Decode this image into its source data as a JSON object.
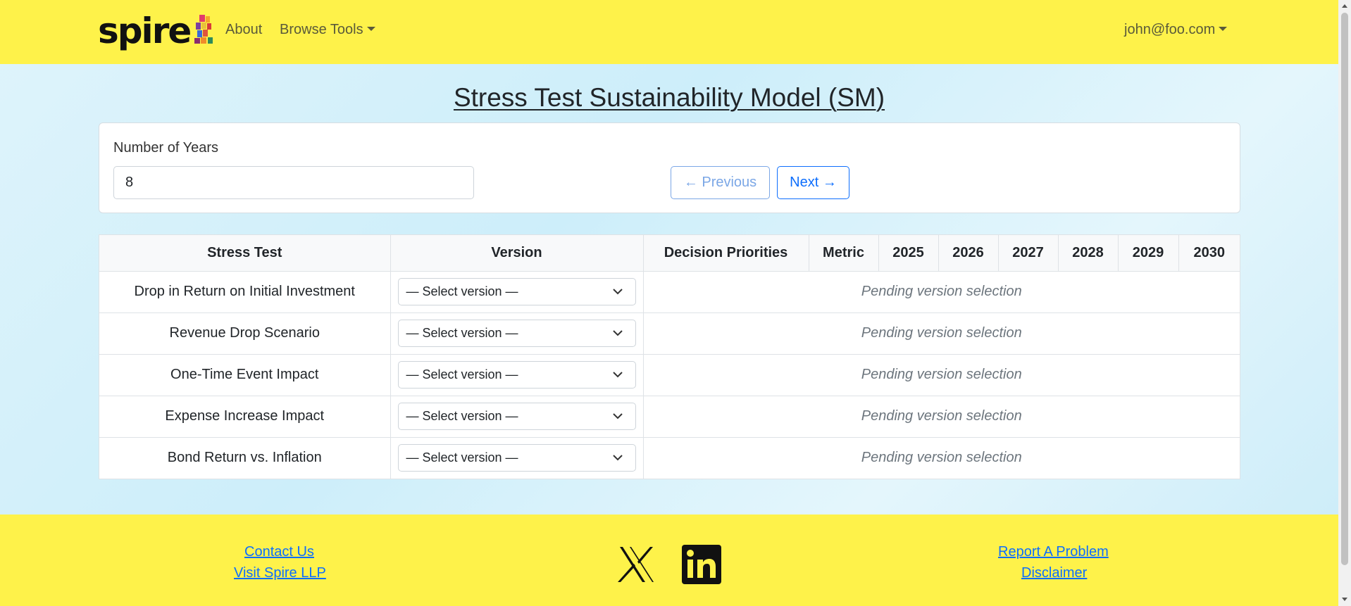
{
  "nav": {
    "brand": "spire",
    "about": "About",
    "browse_tools": "Browse Tools",
    "user": "john@foo.com"
  },
  "page_title": "Stress Test Sustainability Model (SM)",
  "years": {
    "label": "Number of Years",
    "value": "8"
  },
  "pager": {
    "previous": "← Previous",
    "next": "Next →"
  },
  "table": {
    "headers": [
      "Stress Test",
      "Version",
      "Decision Priorities",
      "Metric",
      "2025",
      "2026",
      "2027",
      "2028",
      "2029",
      "2030"
    ],
    "rows": [
      {
        "name": "Drop in Return on Initial Investment",
        "version": "— Select version —",
        "status": "Pending version selection"
      },
      {
        "name": "Revenue Drop Scenario",
        "version": "— Select version —",
        "status": "Pending version selection"
      },
      {
        "name": "One-Time Event Impact",
        "version": "— Select version —",
        "status": "Pending version selection"
      },
      {
        "name": "Expense Increase Impact",
        "version": "— Select version —",
        "status": "Pending version selection"
      },
      {
        "name": "Bond Return vs. Inflation",
        "version": "— Select version —",
        "status": "Pending version selection"
      }
    ]
  },
  "footer": {
    "contact": "Contact Us",
    "visit": "Visit Spire LLP",
    "report": "Report A Problem",
    "disclaimer": "Disclaimer",
    "social": [
      "x-icon",
      "linkedin-icon"
    ]
  },
  "colors": {
    "navbar": "#fef24a",
    "link": "#0d6efd"
  }
}
